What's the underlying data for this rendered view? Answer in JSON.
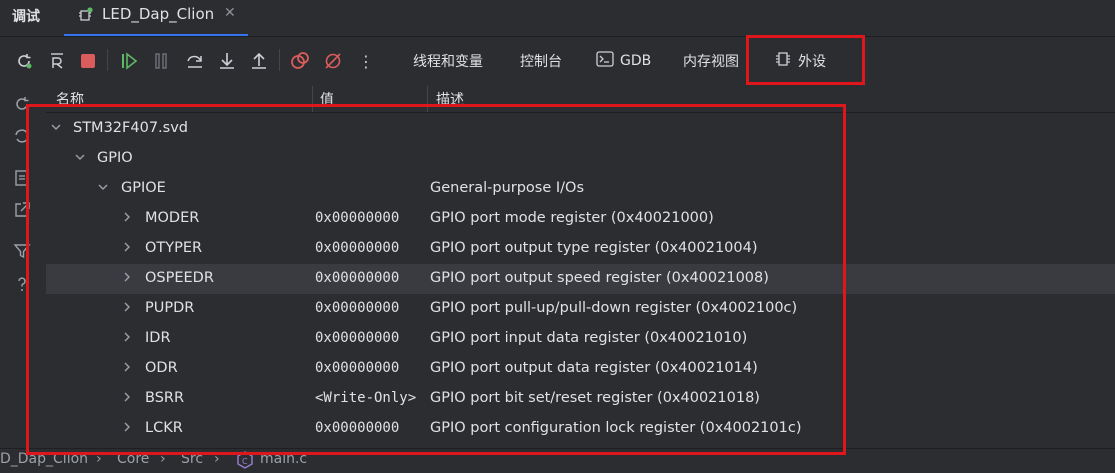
{
  "tabbar": {
    "title": "调试",
    "tab_label": "LED_Dap_Clion",
    "close": "✕"
  },
  "toolbar": {
    "threads_vars": "线程和变量",
    "console": "控制台",
    "gdb": "GDB",
    "memory_view": "内存视图",
    "peripherals": "外设",
    "more": "⋮"
  },
  "columns": {
    "name": "名称",
    "value": "值",
    "description": "描述"
  },
  "tree": {
    "rows": [
      {
        "name": "STM32F407.svd",
        "value": "",
        "desc": "",
        "expanded": true
      },
      {
        "name": "GPIO",
        "value": "",
        "desc": "",
        "expanded": true
      },
      {
        "name": "GPIOE",
        "value": "",
        "desc": "General-purpose I/Os",
        "expanded": true
      },
      {
        "name": "MODER",
        "value": "0x00000000",
        "desc": "GPIO port mode register (0x40021000)",
        "expanded": false
      },
      {
        "name": "OTYPER",
        "value": "0x00000000",
        "desc": "GPIO port output type register (0x40021004)",
        "expanded": false
      },
      {
        "name": "OSPEEDR",
        "value": "0x00000000",
        "desc": "GPIO port output speed register (0x40021008)",
        "expanded": false
      },
      {
        "name": "PUPDR",
        "value": "0x00000000",
        "desc": "GPIO port pull-up/pull-down register (0x4002100c)",
        "expanded": false
      },
      {
        "name": "IDR",
        "value": "0x00000000",
        "desc": "GPIO port input data register (0x40021010)",
        "expanded": false
      },
      {
        "name": "ODR",
        "value": "0x00000000",
        "desc": "GPIO port output data register (0x40021014)",
        "expanded": false
      },
      {
        "name": "BSRR",
        "value": "<Write-Only>",
        "desc": "GPIO port bit set/reset register (0x40021018)",
        "expanded": false
      },
      {
        "name": "LCKR",
        "value": "0x00000000",
        "desc": "GPIO port configuration lock register (0x4002101c)",
        "expanded": false
      }
    ]
  },
  "breadcrumb": {
    "project": "D_Dap_Clion",
    "core": "Core",
    "src": "Src",
    "file": "main.c"
  },
  "colors": {
    "accent": "#3574f0",
    "highlight": "#e0161d",
    "background": "#2b2d30"
  }
}
